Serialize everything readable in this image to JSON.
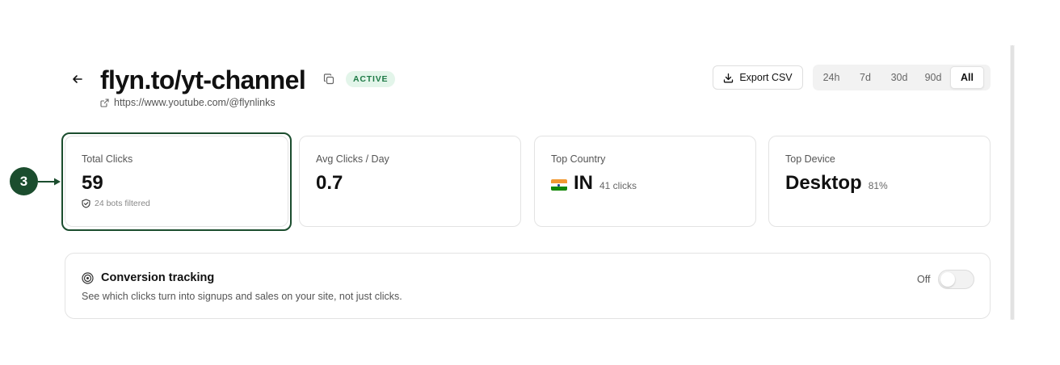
{
  "header": {
    "title": "flyn.to/yt-channel",
    "status_badge": "ACTIVE",
    "destination_url": "https://www.youtube.com/@flynlinks"
  },
  "toolbar": {
    "export_label": "Export CSV",
    "ranges": [
      "24h",
      "7d",
      "30d",
      "90d",
      "All"
    ],
    "active_range": "All"
  },
  "stats": [
    {
      "label": "Total Clicks",
      "value": "59",
      "footnote": "24 bots filtered"
    },
    {
      "label": "Avg Clicks / Day",
      "value": "0.7"
    },
    {
      "label": "Top Country",
      "value": "IN",
      "sub": "41 clicks",
      "flag_icon": "india-flag-icon"
    },
    {
      "label": "Top Device",
      "value": "Desktop",
      "sub": "81%"
    }
  ],
  "conversion": {
    "title": "Conversion tracking",
    "description": "See which clicks turn into signups and sales on your site, not just clicks.",
    "toggle_label": "Off",
    "enabled": false
  },
  "annotation": {
    "step_number": "3"
  },
  "colors": {
    "accent_dark_green": "#1b4d2e",
    "badge_bg": "#e3f5ea",
    "badge_text": "#1e7a46"
  }
}
